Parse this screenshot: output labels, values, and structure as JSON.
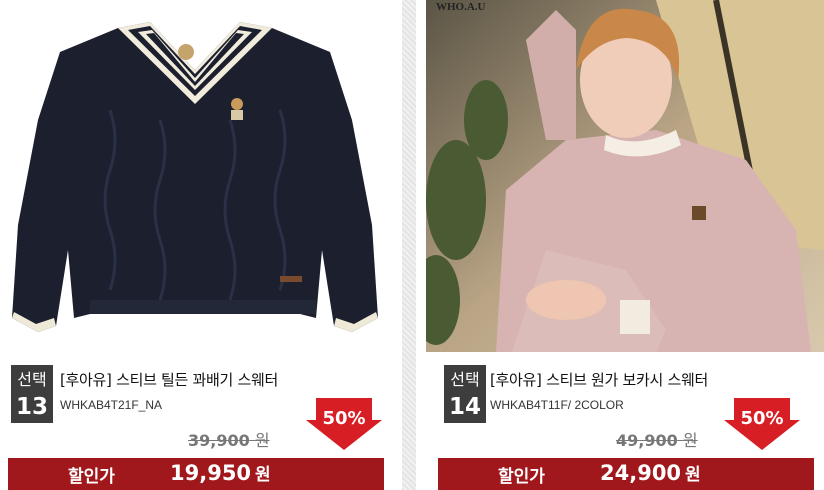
{
  "colors": {
    "sale_bar": "#a0171c",
    "discount_badge": "#d81e25",
    "select_box": "#3d3d3d"
  },
  "products": [
    {
      "select_word": "선택",
      "select_number": "13",
      "title": "[후아유] 스티브 틸든 꽈배기 스웨터",
      "code": "WHKAB4T21F_NA",
      "discount": "50%",
      "original_price": "39,900",
      "original_unit": "원",
      "sale_label": "할인가",
      "sale_price": "19,950",
      "sale_unit": "원",
      "image_icon": "navy-cable-knit-sweater"
    },
    {
      "select_word": "선택",
      "select_number": "14",
      "title": "[후아유] 스티브 원가 보카시 스웨터",
      "code": "WHKAB4T11F/ 2COLOR",
      "discount": "50%",
      "original_price": "49,900",
      "original_unit": "원",
      "sale_label": "할인가",
      "sale_price": "24,900",
      "sale_unit": "원",
      "image_icon": "model-pink-sweater-photo",
      "photo_brand_text": "WHO.A.U"
    }
  ]
}
